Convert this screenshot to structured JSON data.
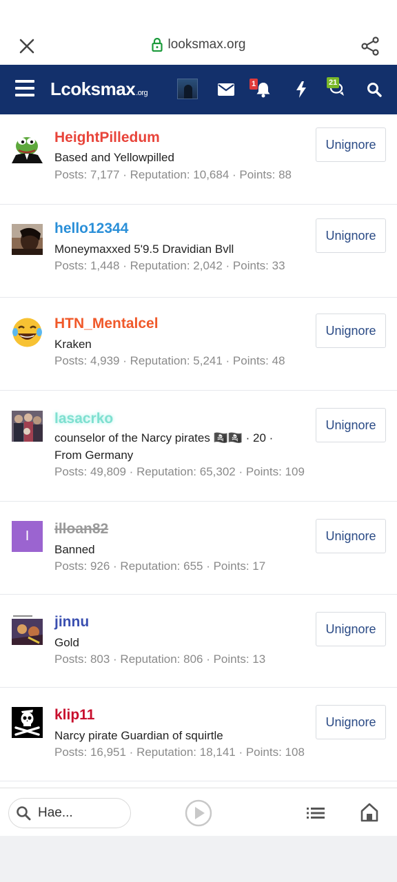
{
  "browser": {
    "url": "looksmax.org"
  },
  "header": {
    "logo_text": "Lcoksmax",
    "logo_suffix": ".org",
    "alerts_badge": "1",
    "conversations_badge": "21"
  },
  "members": [
    {
      "name": "HeightPilledum",
      "name_color": "#e8443a",
      "title": "Based and Yellowpilled",
      "stats": "Posts: 7,177 · Reputation: 10,684 · Points: 88",
      "button": "Unignore",
      "avatar_icon": "pepe-frog-avatar"
    },
    {
      "name": "hello12344",
      "name_color": "#2a8fd8",
      "title": "Moneymaxxed 5'9.5 Dravidian Bvll",
      "stats": "Posts: 1,448 · Reputation: 2,042 · Points: 33",
      "button": "Unignore",
      "avatar_icon": "photo-avatar"
    },
    {
      "name": "HTN_Mentalcel",
      "name_color": "#f0592a",
      "title": "Kraken",
      "stats": "Posts: 4,939 · Reputation: 5,241 · Points: 48",
      "button": "Unignore",
      "avatar_icon": "laughing-crying-emoji-avatar"
    },
    {
      "name": "lasacrko",
      "name_color": "#7fe0d0",
      "title": "counselor of the Narcy pirates 🏴‍☠️🏴‍☠️ · 20 · From Germany",
      "stats": "Posts: 49,809 · Reputation: 65,302 · Points: 109",
      "button": "Unignore",
      "avatar_icon": "crowd-photo-avatar"
    },
    {
      "name": "illoan82",
      "name_color": "#9a9a9a",
      "title": "Banned",
      "stats": "Posts: 926 · Reputation: 655 · Points: 17",
      "button": "Unignore",
      "avatar_letter": "I",
      "avatar_color": "#9b64d0"
    },
    {
      "name": "jinnu",
      "name_color": "#3a4fb0",
      "title": "Gold",
      "stats": "Posts: 803 · Reputation: 806 · Points: 13",
      "button": "Unignore",
      "avatar_icon": "meme-photo-avatar"
    },
    {
      "name": "klip11",
      "name_color": "#c8102e",
      "title": "Narcy pirate Guardian of squirtle",
      "stats": "Posts: 16,951 · Reputation: 18,141 · Points: 108",
      "button": "Unignore",
      "avatar_icon": "jolly-roger-avatar"
    }
  ],
  "bottom_bar": {
    "search_value": "Hae..."
  }
}
